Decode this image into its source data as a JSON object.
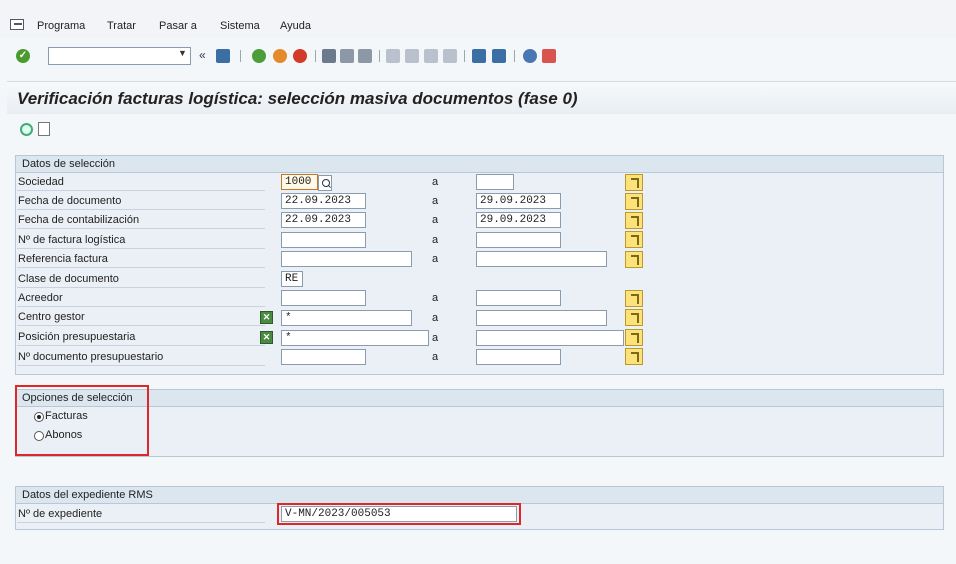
{
  "menu": {
    "items": [
      "Programa",
      "Tratar",
      "Pasar a",
      "Sistema",
      "Ayuda"
    ]
  },
  "toolbar": {
    "command_value": "",
    "back_label": "«"
  },
  "title": "Verificación facturas logística: selección masiva documentos (fase 0)",
  "groups": {
    "selection": {
      "header": "Datos de selección",
      "to_label": "a",
      "rows": [
        {
          "label": "Sociedad",
          "from": "1000",
          "to": ""
        },
        {
          "label": "Fecha de documento",
          "from": "22.09.2023",
          "to": "29.09.2023"
        },
        {
          "label": "Fecha de contabilización",
          "from": "22.09.2023",
          "to": "29.09.2023"
        },
        {
          "label": "Nº de factura logística",
          "from": "",
          "to": ""
        },
        {
          "label": "Referencia factura",
          "from": "",
          "to": ""
        },
        {
          "label": "Clase de documento",
          "from": "RE"
        },
        {
          "label": "Acreedor",
          "from": "",
          "to": ""
        },
        {
          "label": "Centro gestor",
          "from": "*",
          "to": ""
        },
        {
          "label": "Posición presupuestaria",
          "from": "*",
          "to": ""
        },
        {
          "label": "Nº documento presupuestario",
          "from": "",
          "to": ""
        }
      ]
    },
    "options": {
      "header": "Opciones de selección",
      "radios": [
        {
          "label": "Facturas",
          "selected": true
        },
        {
          "label": "Abonos",
          "selected": false
        }
      ]
    },
    "rms": {
      "header": "Datos del expediente RMS",
      "label": "Nº de expediente",
      "value": "V-MN/2023/005053"
    }
  },
  "colors": {
    "highlight": "#e02626",
    "group_bg": "#eaf0f5",
    "multisel_button": "#fde27a"
  }
}
